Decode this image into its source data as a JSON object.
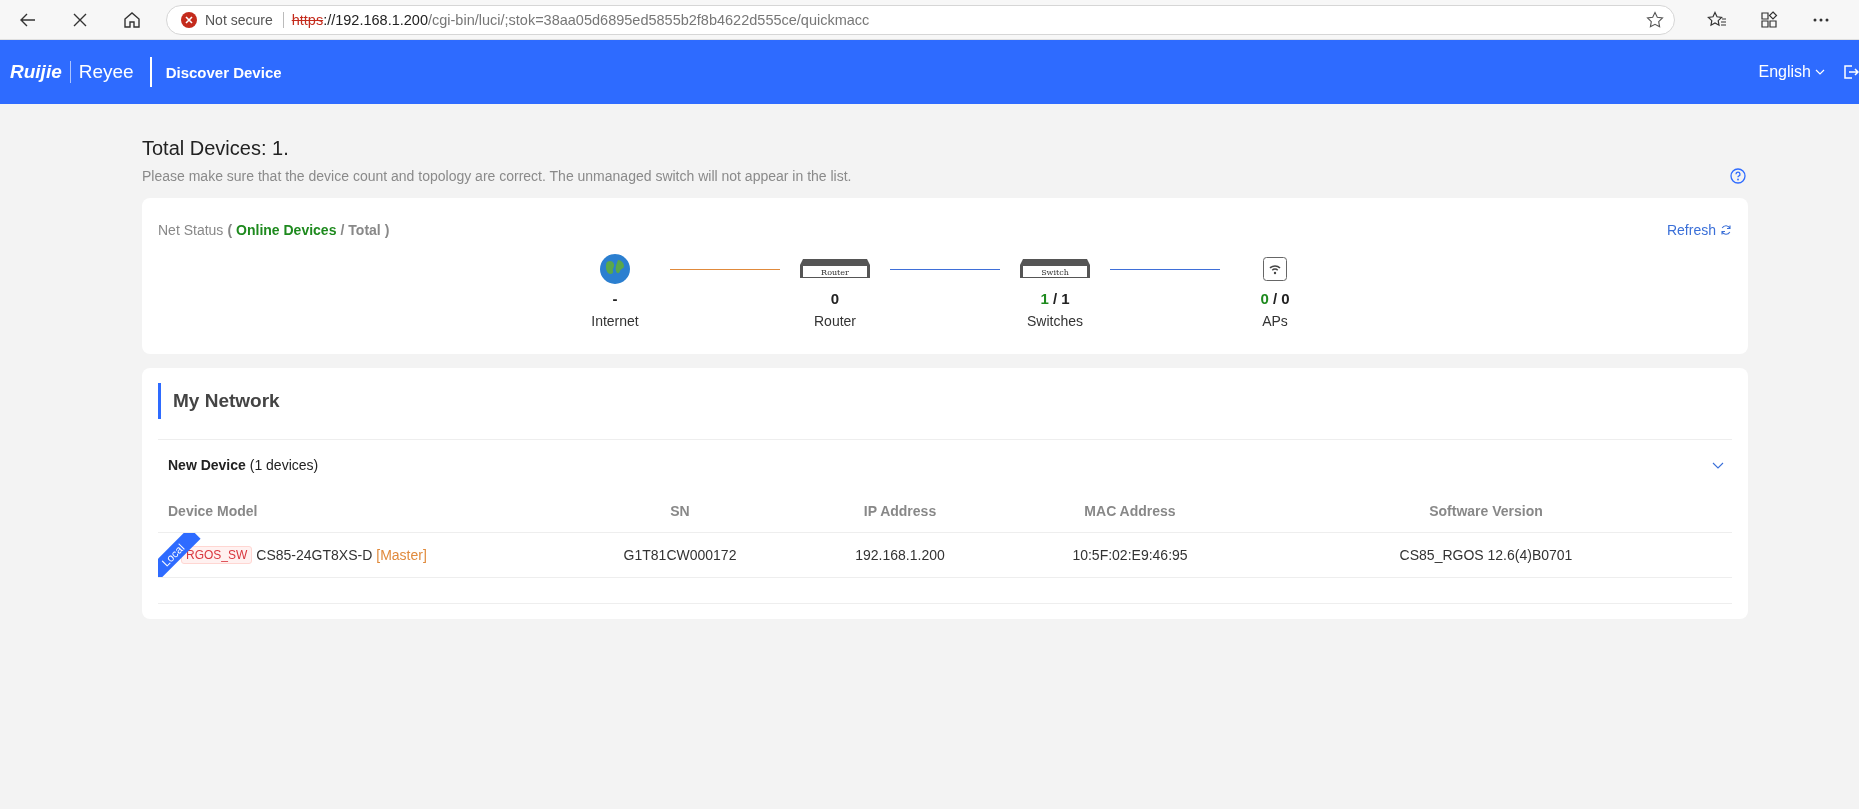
{
  "browser": {
    "security_label": "Not secure",
    "url_scheme": "https",
    "url_host": "://192.168.1.200",
    "url_path": "/cgi-bin/luci/;stok=38aa05d6895ed5855b2f8b4622d555ce/quickmacc"
  },
  "header": {
    "logo_primary": "Ruijie",
    "logo_secondary": "Reyee",
    "title": "Discover Device",
    "language": "English"
  },
  "summary": {
    "title": "Total Devices: 1.",
    "hint": "Please make sure that the device count and topology are correct. The unmanaged switch will not appear in the list."
  },
  "net_status": {
    "legend": [
      {
        "kind": "plain",
        "text": "Net Status"
      },
      {
        "kind": "punct",
        "text": "("
      },
      {
        "kind": "online",
        "text": "Online Devices"
      },
      {
        "kind": "punct",
        "text": "/"
      },
      {
        "kind": "punct",
        "text": "Total"
      },
      {
        "kind": "punct",
        "text": ")"
      }
    ],
    "refresh": "Refresh",
    "nodes": [
      {
        "kind": "globe",
        "total": "-",
        "name": "Internet"
      },
      {
        "kind": "router",
        "device_label": "Router",
        "total": "0",
        "name": "Router"
      },
      {
        "kind": "switch",
        "device_label": "Switch",
        "online": "1",
        "separator": "/",
        "total": "1",
        "name": "Switches"
      },
      {
        "kind": "ap",
        "online": "0",
        "separator": "/",
        "total": "0",
        "name": "APs"
      }
    ],
    "links": [
      {
        "color": "#e08a3c"
      },
      {
        "color": "#3f6fd8"
      },
      {
        "color": "#3f6fd8"
      }
    ]
  },
  "my_network": {
    "title": "My Network",
    "group": {
      "title": "New Device",
      "count": "(1 devices)",
      "expanded": true
    },
    "columns": [
      "Device Model",
      "SN",
      "IP Address",
      "MAC Address",
      "Software Version"
    ],
    "rows": [
      {
        "local_badge": "Local",
        "tag": "RGOS_SW",
        "model": "CS85-24GT8XS-D",
        "role": "[Master]",
        "sn": "G1T81CW000172",
        "ip": "192.168.1.200",
        "mac": "10:5F:02:E9:46:95",
        "software": "CS85_RGOS 12.6(4)B0701"
      }
    ]
  }
}
